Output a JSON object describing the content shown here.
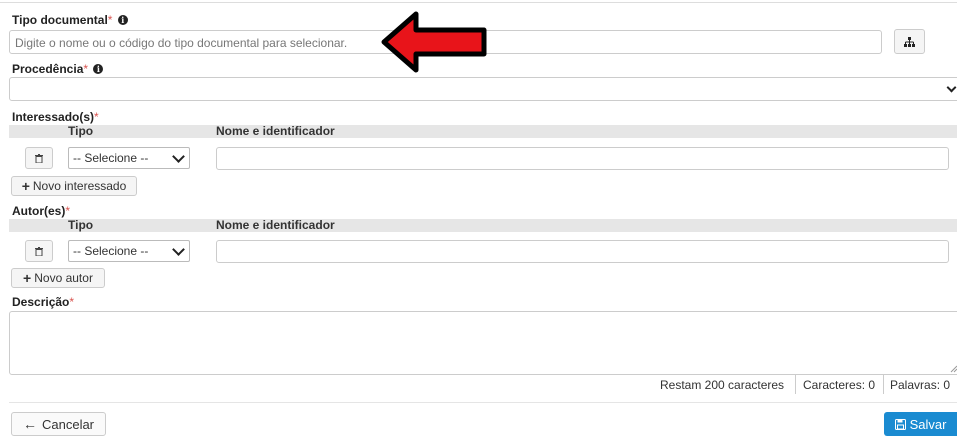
{
  "form": {
    "tipo_documental": {
      "label": "Tipo documental",
      "required_mark": "*",
      "placeholder": "Digite o nome ou o código do tipo documental para selecionar."
    },
    "procedencia": {
      "label": "Procedência",
      "required_mark": "*",
      "value": ""
    },
    "interessados": {
      "label": "Interessado(s)",
      "required_mark": "*",
      "columns": [
        "Tipo",
        "Nome e identificador"
      ],
      "select_value": "-- Selecione --",
      "add_label": "Novo interessado"
    },
    "autores": {
      "label": "Autor(es)",
      "required_mark": "*",
      "columns": [
        "Tipo",
        "Nome e identificador"
      ],
      "select_value": "-- Selecione --",
      "add_label": "Novo autor"
    },
    "descricao": {
      "label": "Descrição",
      "required_mark": "*",
      "value": ""
    },
    "counters": {
      "remaining": "Restam 200 caracteres",
      "chars": "Caracteres: 0",
      "words": "Palavras: 0"
    }
  },
  "actions": {
    "cancel_label": "Cancelar",
    "save_label": "Salvar"
  },
  "colors": {
    "arrow_fill": "#e8141a",
    "save_button": "#1a8bd1",
    "required": "#d9534f"
  }
}
